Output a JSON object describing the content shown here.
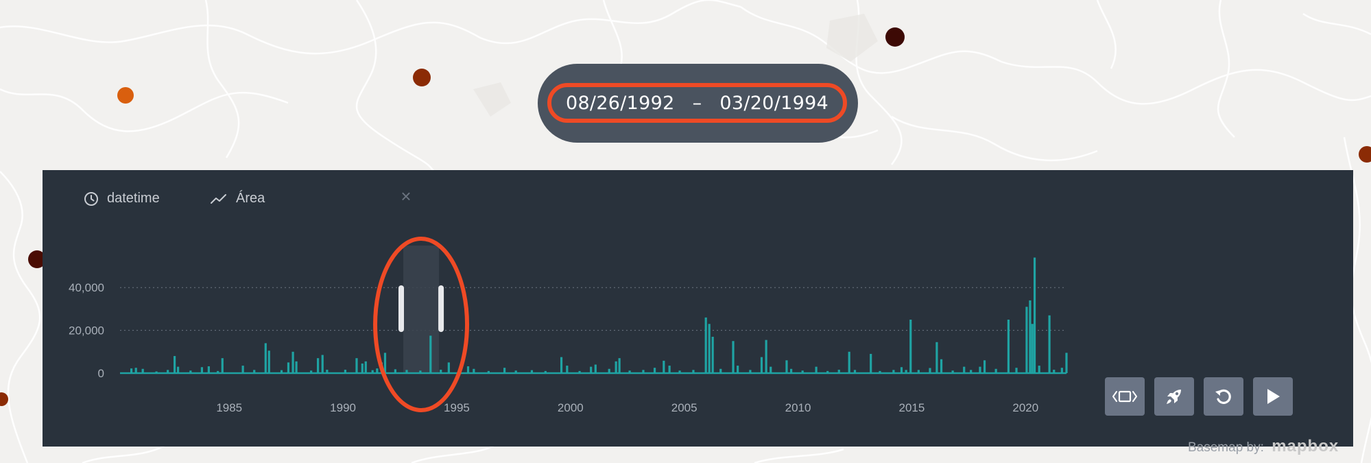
{
  "range": {
    "start": "08/26/1992",
    "separator": "–",
    "end": "03/20/1994"
  },
  "legend": {
    "time_field": "datetime",
    "time_icon": "clock-icon",
    "series_label": "Área",
    "series_icon": "line-chart-icon",
    "close_icon": "close-icon",
    "close_glyph": "×"
  },
  "controls": [
    {
      "name": "window-mode-button",
      "icon": "window-brackets-icon"
    },
    {
      "name": "speed-button",
      "icon": "rocket-icon"
    },
    {
      "name": "reset-button",
      "icon": "reset-icon"
    },
    {
      "name": "play-button",
      "icon": "play-icon"
    }
  ],
  "attribution": {
    "text": "Basemap by:",
    "logo": "mapbox"
  },
  "colors": {
    "panel": "#29323c",
    "series": "#1fa3a3",
    "highlight": "#ef4a25",
    "button": "#6a7485",
    "pill": "#4a535f"
  },
  "map_dots": [
    {
      "x": 183,
      "y": 139,
      "r": 12,
      "color": "#d95f0e"
    },
    {
      "x": 615,
      "y": 113,
      "r": 13,
      "color": "#8b2b05"
    },
    {
      "x": 1305,
      "y": 54,
      "r": 14,
      "color": "#3d0a05"
    },
    {
      "x": 54,
      "y": 378,
      "r": 13,
      "color": "#4a0d04"
    },
    {
      "x": 1993,
      "y": 225,
      "r": 12,
      "color": "#8b2b05"
    },
    {
      "x": 2,
      "y": 582,
      "r": 10,
      "color": "#8b2b05"
    }
  ],
  "chart_data": {
    "type": "bar",
    "x_range": [
      1980.2,
      2021.8
    ],
    "ylim": [
      0,
      50000
    ],
    "y_ticks": [
      {
        "value": 0,
        "label": "0"
      },
      {
        "value": 20000,
        "label": "20,000"
      },
      {
        "value": 40000,
        "label": "40,000"
      }
    ],
    "x_ticks": [
      {
        "value": 1985,
        "label": "1985"
      },
      {
        "value": 1990,
        "label": "1990"
      },
      {
        "value": 1995,
        "label": "1995"
      },
      {
        "value": 2000,
        "label": "2000"
      },
      {
        "value": 2005,
        "label": "2005"
      },
      {
        "value": 2010,
        "label": "2010"
      },
      {
        "value": 2015,
        "label": "2015"
      },
      {
        "value": 2020,
        "label": "2020"
      }
    ],
    "grid": "dotted-y",
    "brush": {
      "start": 1992.65,
      "end": 1994.22
    },
    "spikes": [
      {
        "x": 1980.7,
        "y": 2200
      },
      {
        "x": 1980.9,
        "y": 2500
      },
      {
        "x": 1981.2,
        "y": 2000
      },
      {
        "x": 1981.8,
        "y": 800
      },
      {
        "x": 1982.3,
        "y": 1500
      },
      {
        "x": 1982.6,
        "y": 8000
      },
      {
        "x": 1982.75,
        "y": 3000
      },
      {
        "x": 1983.3,
        "y": 1200
      },
      {
        "x": 1983.8,
        "y": 2800
      },
      {
        "x": 1984.1,
        "y": 3200
      },
      {
        "x": 1984.5,
        "y": 1000
      },
      {
        "x": 1984.7,
        "y": 7000
      },
      {
        "x": 1985.6,
        "y": 3500
      },
      {
        "x": 1986.1,
        "y": 1500
      },
      {
        "x": 1986.6,
        "y": 14000
      },
      {
        "x": 1986.75,
        "y": 10500
      },
      {
        "x": 1987.3,
        "y": 1400
      },
      {
        "x": 1987.6,
        "y": 5000
      },
      {
        "x": 1987.8,
        "y": 10000
      },
      {
        "x": 1987.95,
        "y": 5500
      },
      {
        "x": 1988.6,
        "y": 1200
      },
      {
        "x": 1988.9,
        "y": 7000
      },
      {
        "x": 1989.1,
        "y": 8500
      },
      {
        "x": 1989.3,
        "y": 1600
      },
      {
        "x": 1990.1,
        "y": 1600
      },
      {
        "x": 1990.6,
        "y": 7000
      },
      {
        "x": 1990.85,
        "y": 4500
      },
      {
        "x": 1991.0,
        "y": 5500
      },
      {
        "x": 1991.3,
        "y": 1400
      },
      {
        "x": 1991.5,
        "y": 2200
      },
      {
        "x": 1991.7,
        "y": 5000
      },
      {
        "x": 1991.85,
        "y": 9500
      },
      {
        "x": 1992.3,
        "y": 1800
      },
      {
        "x": 1992.8,
        "y": 1500
      },
      {
        "x": 1993.4,
        "y": 1200
      },
      {
        "x": 1993.85,
        "y": 17500
      },
      {
        "x": 1994.3,
        "y": 1600
      },
      {
        "x": 1994.65,
        "y": 5000
      },
      {
        "x": 1995.1,
        "y": 1400
      },
      {
        "x": 1995.5,
        "y": 3200
      },
      {
        "x": 1995.75,
        "y": 2000
      },
      {
        "x": 1996.4,
        "y": 1000
      },
      {
        "x": 1997.1,
        "y": 2500
      },
      {
        "x": 1997.6,
        "y": 1200
      },
      {
        "x": 1998.3,
        "y": 1400
      },
      {
        "x": 1998.9,
        "y": 1000
      },
      {
        "x": 1999.6,
        "y": 7500
      },
      {
        "x": 1999.85,
        "y": 3500
      },
      {
        "x": 2000.4,
        "y": 1000
      },
      {
        "x": 2000.9,
        "y": 3000
      },
      {
        "x": 2001.1,
        "y": 4000
      },
      {
        "x": 2001.7,
        "y": 2000
      },
      {
        "x": 2002.0,
        "y": 5500
      },
      {
        "x": 2002.15,
        "y": 7000
      },
      {
        "x": 2002.6,
        "y": 1200
      },
      {
        "x": 2003.2,
        "y": 1500
      },
      {
        "x": 2003.7,
        "y": 2500
      },
      {
        "x": 2004.1,
        "y": 5800
      },
      {
        "x": 2004.35,
        "y": 3500
      },
      {
        "x": 2004.8,
        "y": 1200
      },
      {
        "x": 2005.4,
        "y": 1500
      },
      {
        "x": 2005.95,
        "y": 26000
      },
      {
        "x": 2006.1,
        "y": 23000
      },
      {
        "x": 2006.25,
        "y": 17000
      },
      {
        "x": 2006.6,
        "y": 2000
      },
      {
        "x": 2007.15,
        "y": 15000
      },
      {
        "x": 2007.35,
        "y": 3500
      },
      {
        "x": 2007.9,
        "y": 1500
      },
      {
        "x": 2008.4,
        "y": 7500
      },
      {
        "x": 2008.6,
        "y": 15500
      },
      {
        "x": 2008.8,
        "y": 3000
      },
      {
        "x": 2009.5,
        "y": 6000
      },
      {
        "x": 2009.7,
        "y": 2000
      },
      {
        "x": 2010.2,
        "y": 1200
      },
      {
        "x": 2010.8,
        "y": 3000
      },
      {
        "x": 2011.3,
        "y": 1000
      },
      {
        "x": 2011.8,
        "y": 1600
      },
      {
        "x": 2012.25,
        "y": 10000
      },
      {
        "x": 2012.5,
        "y": 1500
      },
      {
        "x": 2013.2,
        "y": 9000
      },
      {
        "x": 2013.6,
        "y": 1000
      },
      {
        "x": 2014.2,
        "y": 1500
      },
      {
        "x": 2014.55,
        "y": 2800
      },
      {
        "x": 2014.75,
        "y": 1500
      },
      {
        "x": 2014.95,
        "y": 25000
      },
      {
        "x": 2015.3,
        "y": 1500
      },
      {
        "x": 2015.8,
        "y": 2400
      },
      {
        "x": 2016.1,
        "y": 14500
      },
      {
        "x": 2016.3,
        "y": 6500
      },
      {
        "x": 2016.8,
        "y": 1200
      },
      {
        "x": 2017.3,
        "y": 3000
      },
      {
        "x": 2017.6,
        "y": 1500
      },
      {
        "x": 2018.0,
        "y": 3000
      },
      {
        "x": 2018.2,
        "y": 6000
      },
      {
        "x": 2018.7,
        "y": 2000
      },
      {
        "x": 2019.25,
        "y": 25000
      },
      {
        "x": 2019.6,
        "y": 2500
      },
      {
        "x": 2020.05,
        "y": 31000
      },
      {
        "x": 2020.2,
        "y": 34000
      },
      {
        "x": 2020.3,
        "y": 23000
      },
      {
        "x": 2020.4,
        "y": 54000
      },
      {
        "x": 2020.6,
        "y": 3500
      },
      {
        "x": 2021.05,
        "y": 27000
      },
      {
        "x": 2021.25,
        "y": 1600
      },
      {
        "x": 2021.6,
        "y": 2500
      },
      {
        "x": 2021.8,
        "y": 9500
      }
    ]
  }
}
